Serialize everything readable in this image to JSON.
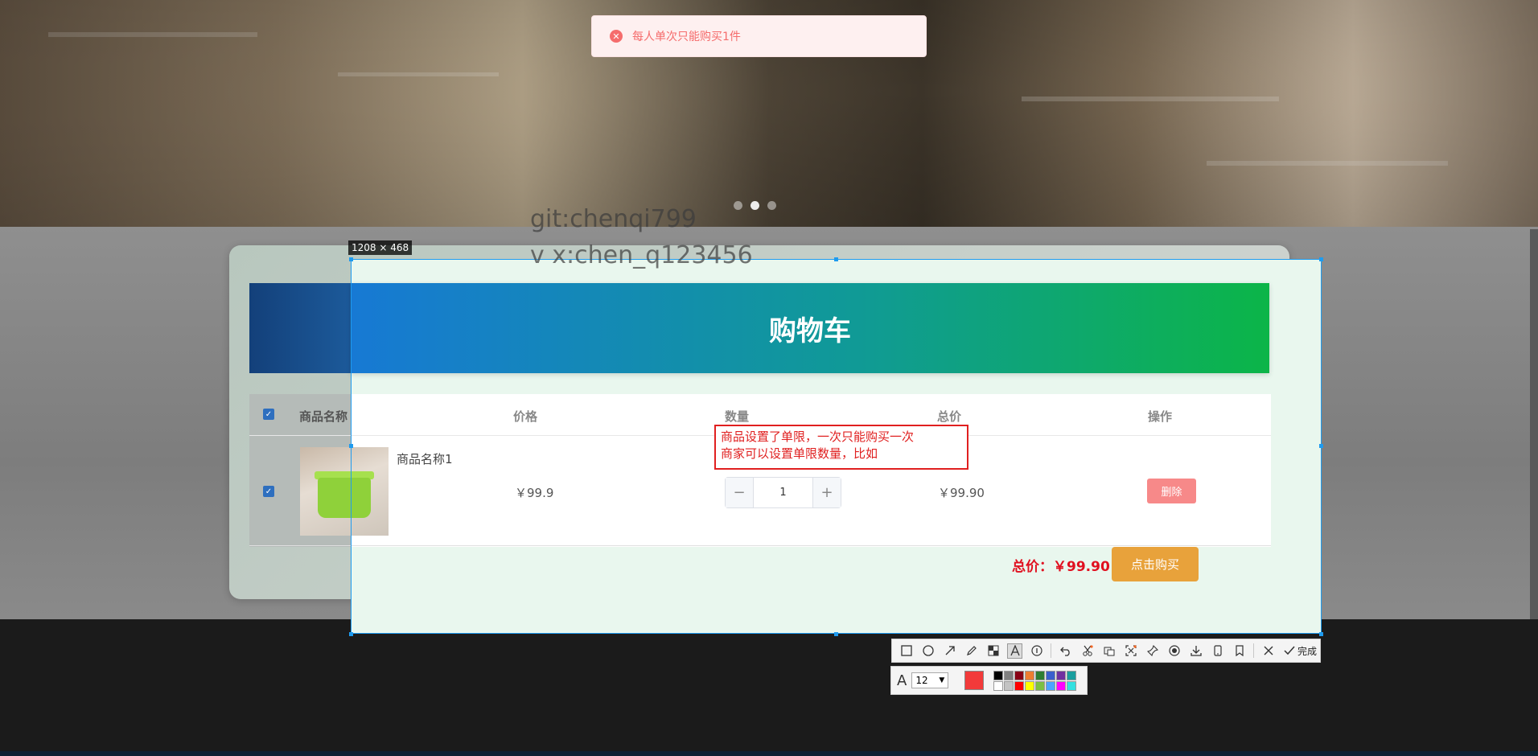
{
  "toast": {
    "message": "每人单次只能购买1件",
    "color": "#f56c6c"
  },
  "carousel": {
    "dot_count": 3,
    "active_index": 1
  },
  "screenshot_tool": {
    "dimension_label": "1208 × 468",
    "watermark_line1": "git:chenqi799",
    "watermark_line2": "v x:chen_q123456",
    "selection_color": "#1e9bef",
    "annotation_line1": "商品设置了单限，一次只能购买一次",
    "annotation_line2": "商家可以设置单限数量，比如",
    "annotation_color": "#e02020",
    "toolbar_icons": [
      "rectangle-icon",
      "ellipse-icon",
      "arrow-icon",
      "pencil-icon",
      "mosaic-icon",
      "text-icon",
      "serial-number-icon",
      "undo-icon",
      "scissor-icon",
      "ocr-icon",
      "scroll-capture-icon",
      "pin-icon",
      "record-icon",
      "download-icon",
      "phone-icon",
      "bookmark-icon",
      "close-icon"
    ],
    "done_label": "完成",
    "font_size_value": "12",
    "current_color": "#f23a3a",
    "palette_top": [
      "#000000",
      "#7f7f7f",
      "#880015",
      "#ed7d31",
      "#2e7d32",
      "#3a5fcd",
      "#7030a0",
      "#1a9e9e"
    ],
    "palette_bottom": [
      "#ffffff",
      "#c3c3c3",
      "#ff0000",
      "#ffff00",
      "#7bc043",
      "#4ba3ff",
      "#ff00ff",
      "#33e0e0"
    ]
  },
  "cart": {
    "title": "购物车",
    "headers": {
      "name": "商品名称",
      "price": "价格",
      "quantity": "数量",
      "total": "总价",
      "action": "操作"
    },
    "items": [
      {
        "name": "商品名称1",
        "price": "￥99.9",
        "quantity": "1",
        "subtotal": "￥99.90",
        "delete_label": "删除",
        "checked": true
      }
    ],
    "total_label": "总价：￥99.90",
    "buy_label": "点击购买",
    "qty_minus": "−",
    "qty_plus": "+"
  }
}
